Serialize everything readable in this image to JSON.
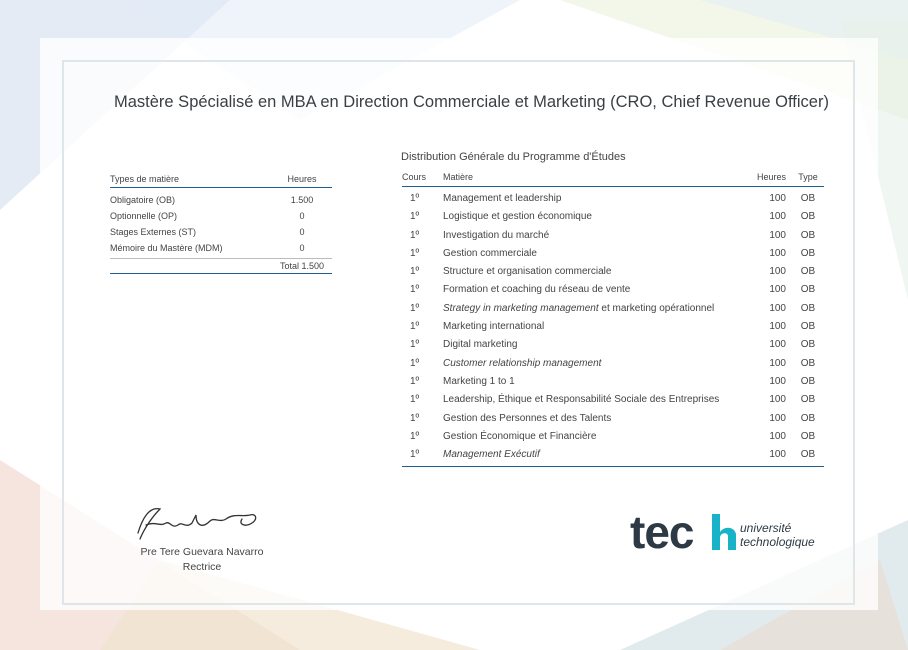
{
  "title": "Mastère Spécialisé en MBA en Direction Commerciale et Marketing (CRO, Chief Revenue Officer)",
  "summary": {
    "col_type": "Types de matière",
    "col_hours": "Heures",
    "rows": [
      {
        "label": "Obligatoire (OB)",
        "hours": "1.500"
      },
      {
        "label": "Optionnelle (OP)",
        "hours": "0"
      },
      {
        "label": "Stages Externes (ST)",
        "hours": "0"
      },
      {
        "label": "Mémoire du Mastère (MDM)",
        "hours": "0"
      }
    ],
    "total": "Total 1.500"
  },
  "distribution": {
    "title": "Distribution Générale du Programme d'Études",
    "headers": {
      "course": "Cours",
      "subject": "Matière",
      "hours": "Heures",
      "type": "Type"
    },
    "rows": [
      {
        "course": "1º",
        "subject": "Management et leadership",
        "hours": "100",
        "type": "OB",
        "italic": false
      },
      {
        "course": "1º",
        "subject": "Logistique et gestion économique",
        "hours": "100",
        "type": "OB",
        "italic": false
      },
      {
        "course": "1º",
        "subject": "Investigation du marché",
        "hours": "100",
        "type": "OB",
        "italic": false
      },
      {
        "course": "1º",
        "subject": "Gestion commerciale",
        "hours": "100",
        "type": "OB",
        "italic": false
      },
      {
        "course": "1º",
        "subject": "Structure et organisation commerciale",
        "hours": "100",
        "type": "OB",
        "italic": false
      },
      {
        "course": "1º",
        "subject": "Formation et coaching du réseau de vente",
        "hours": "100",
        "type": "OB",
        "italic": false
      },
      {
        "course": "1º",
        "subject_italic": "Strategy in marketing management",
        "subject_rest": " et marketing opérationnel",
        "hours": "100",
        "type": "OB",
        "mixed": true
      },
      {
        "course": "1º",
        "subject": "Marketing international",
        "hours": "100",
        "type": "OB",
        "italic": false
      },
      {
        "course": "1º",
        "subject": "Digital marketing",
        "hours": "100",
        "type": "OB",
        "italic": false
      },
      {
        "course": "1º",
        "subject": "Customer relationship management",
        "hours": "100",
        "type": "OB",
        "italic": true
      },
      {
        "course": "1º",
        "subject": "Marketing 1 to 1",
        "hours": "100",
        "type": "OB",
        "italic": false
      },
      {
        "course": "1º",
        "subject": "Leadership, Éthique et Responsabilité Sociale des Entreprises",
        "hours": "100",
        "type": "OB",
        "italic": false
      },
      {
        "course": "1º",
        "subject": "Gestion des Personnes et des Talents",
        "hours": "100",
        "type": "OB",
        "italic": false
      },
      {
        "course": "1º",
        "subject": "Gestion Économique et Financière",
        "hours": "100",
        "type": "OB",
        "italic": false
      },
      {
        "course": "1º",
        "subject": "Management Exécutif",
        "hours": "100",
        "type": "OB",
        "italic": true
      }
    ]
  },
  "signatory": {
    "name": "Pre Tere Guevara Navarro",
    "role": "Rectrice"
  },
  "logo": {
    "word": "tech",
    "line1": "université",
    "line2": "technologique",
    "accent": "#18b3c8",
    "dark": "#2d3a45"
  },
  "colors": {
    "rule": "#1f5f8f"
  }
}
